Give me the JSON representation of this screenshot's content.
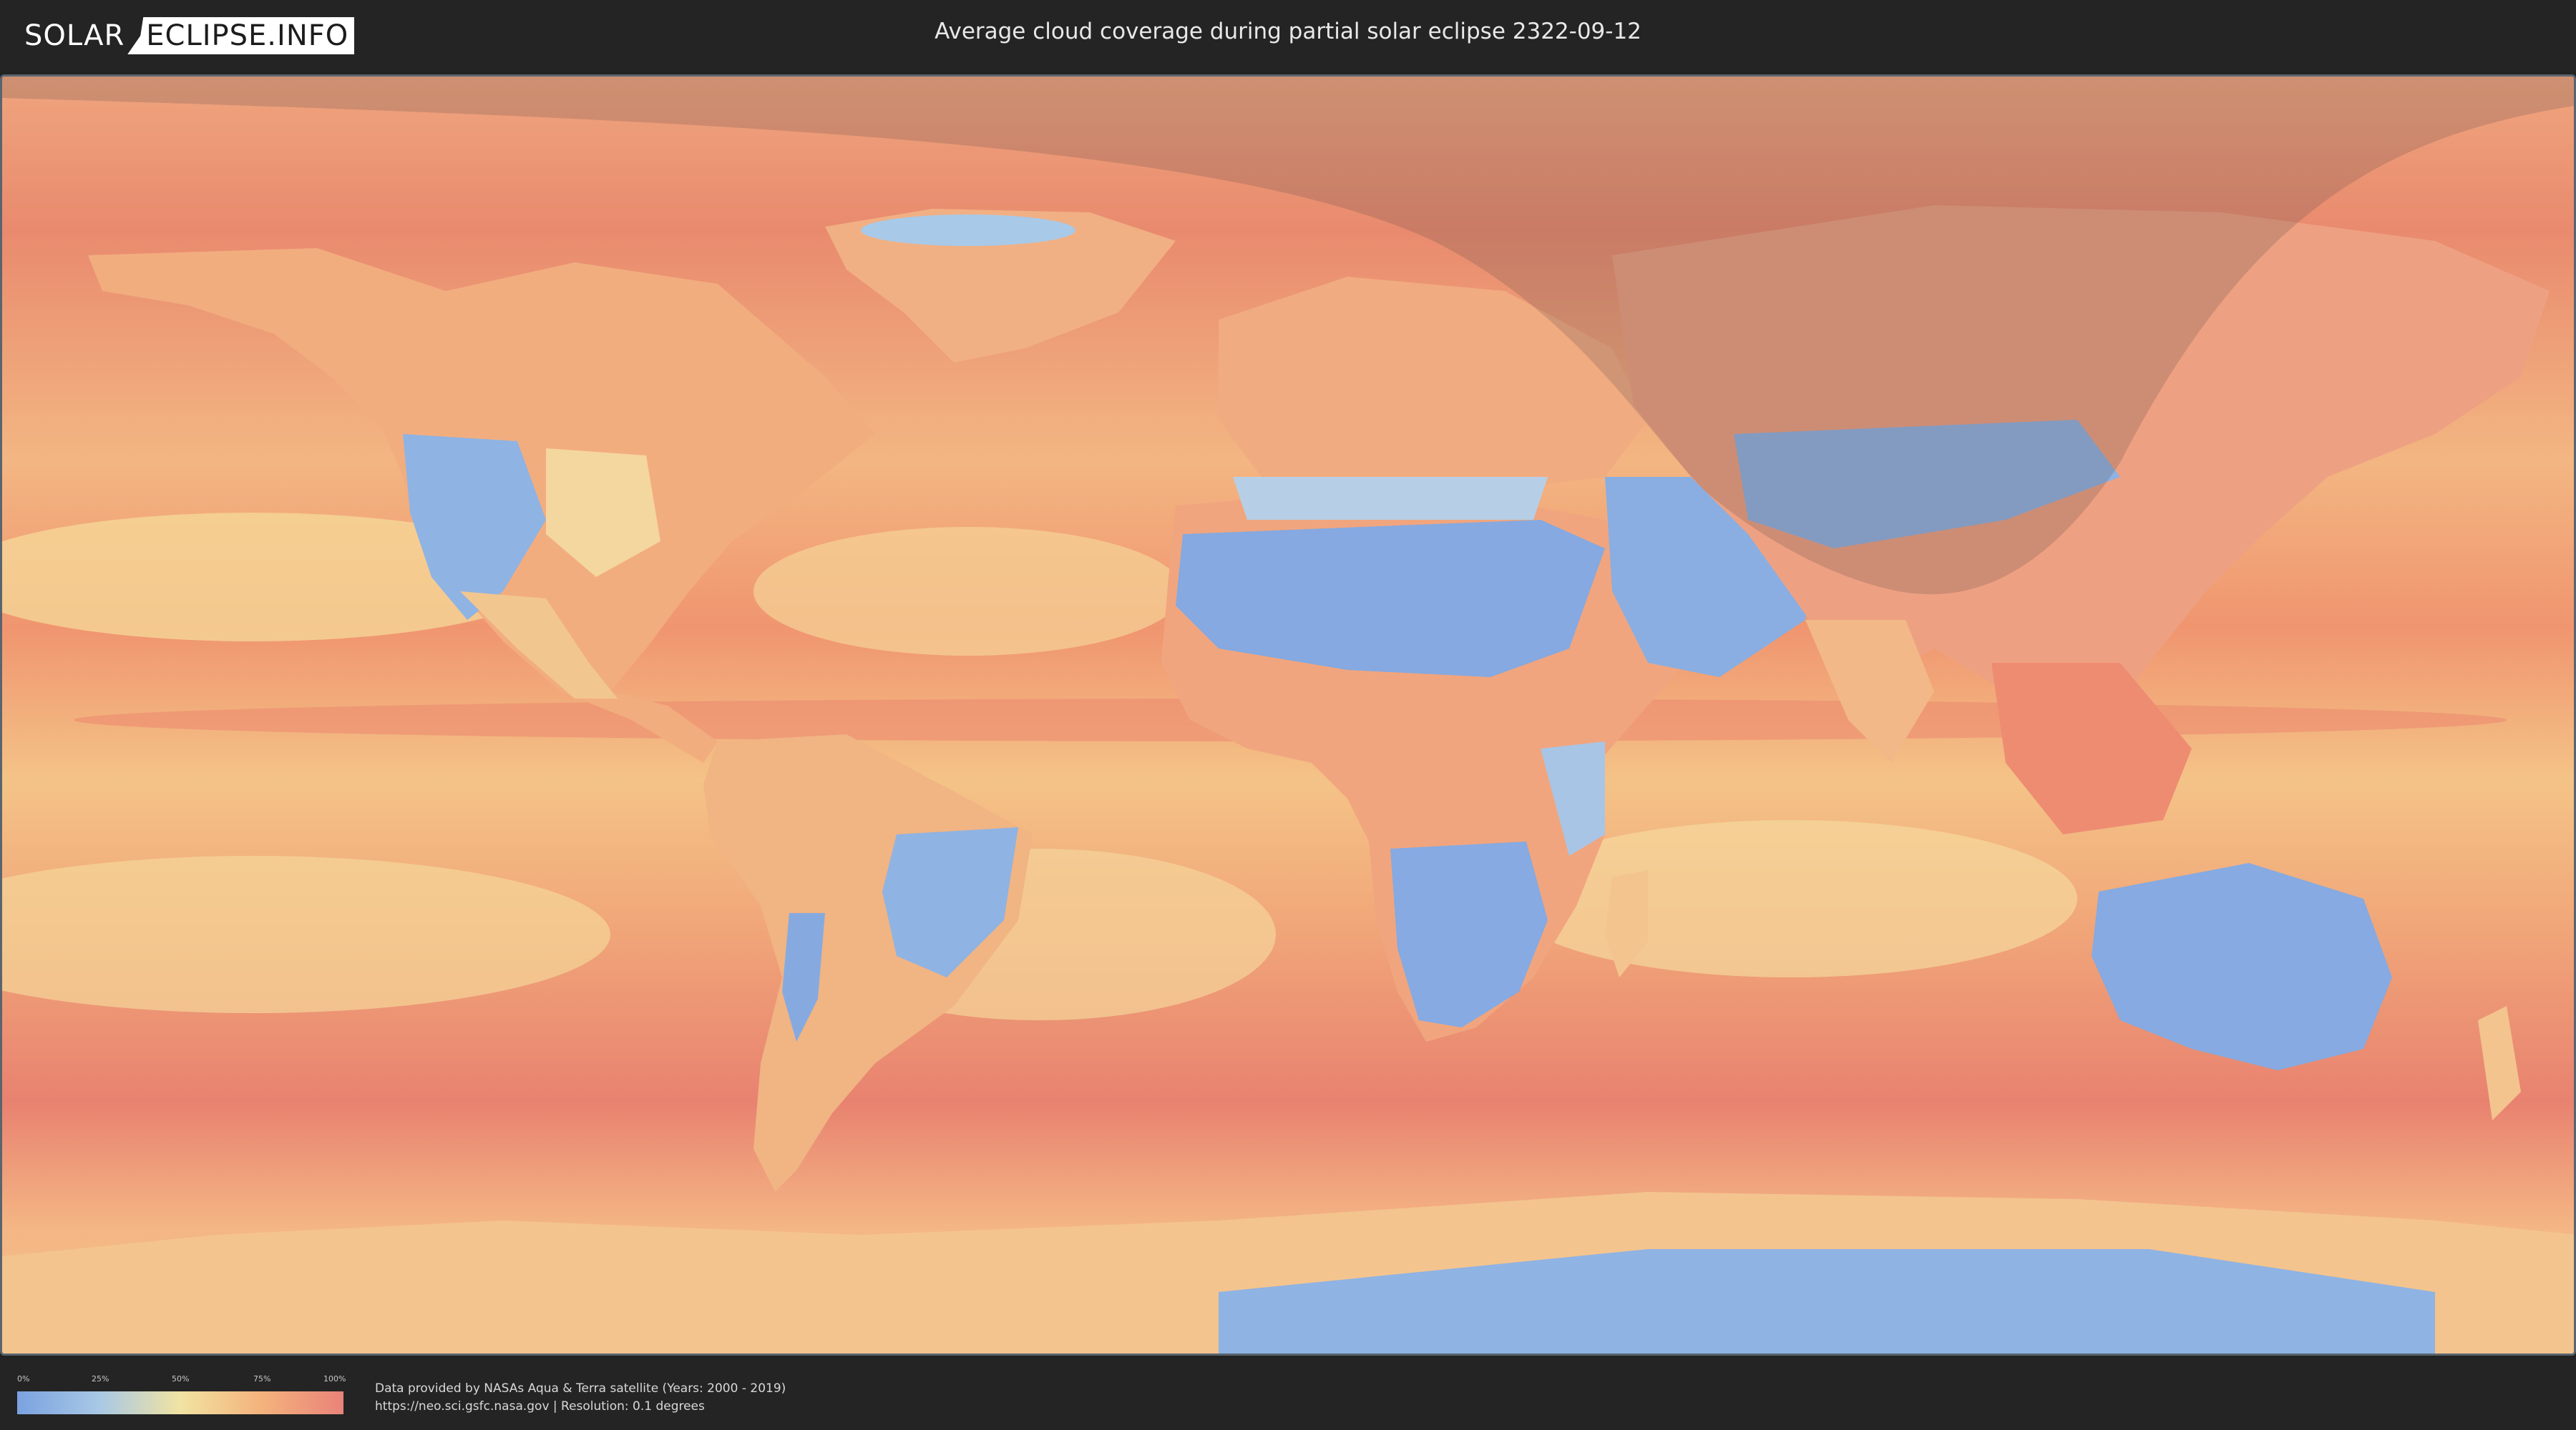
{
  "header": {
    "logo_part1": "SOLAR",
    "logo_part2": "ECLIPSE.INFO",
    "title": "Average cloud coverage during partial solar eclipse 2322-09-12"
  },
  "map": {
    "layer": "average cloud coverage",
    "overlay": "partial solar eclipse visibility zone (shaded)",
    "colors": {
      "clear": "#7aa2e0",
      "low": "#a8c8e6",
      "mid": "#f1e3a2",
      "high": "#f4b27c",
      "overcast": "#e9837a",
      "eclipse_shade": "#5a4a4a"
    }
  },
  "legend": {
    "ticks": [
      "0%",
      "25%",
      "50%",
      "75%",
      "100%"
    ]
  },
  "credits": {
    "line1": "Data provided by NASAs Aqua & Terra satellite (Years: 2000 - 2019)",
    "line2": "https://neo.sci.gsfc.nasa.gov | Resolution: 0.1 degrees"
  }
}
